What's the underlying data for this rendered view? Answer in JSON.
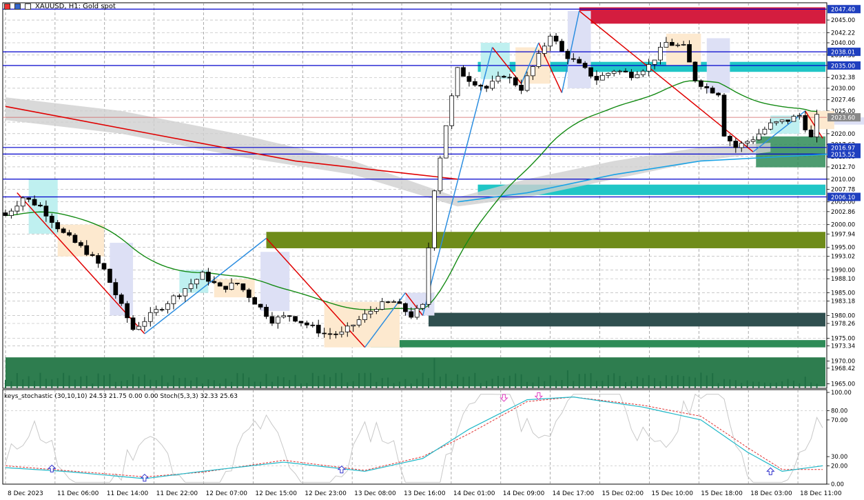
{
  "header": {
    "title": "XAUUSD, H1:  Gold spot"
  },
  "indicator": {
    "title": "keys_stochastic (30,10,10) 24.53 21.75 0.00 0.00 Stoch(5,3,3) 32.33 25.63"
  },
  "colors": {
    "bull": "#ffffff",
    "bear": "#000000",
    "ema_green": "#138a13",
    "ema_blue": "#1aa3e6",
    "line_red": "#e00000",
    "zigzag_blue": "#2b8de0",
    "hline": "#0000cc",
    "volume": "#2e8b57"
  },
  "chart_data": {
    "type": "candlestick",
    "symbol": "XAUUSD",
    "timeframe": "H1",
    "price_axis": {
      "ticks": [
        2045.0,
        2042.22,
        2040.0,
        2037.3,
        2035.0,
        2032.38,
        2030.0,
        2027.46,
        2025.0,
        2022.54,
        2020.0,
        2017.62,
        2015.0,
        2012.7,
        2010.0,
        2007.78,
        2005.0,
        2002.86,
        2000.0,
        1997.94,
        1995.0,
        1993.02,
        1990.0,
        1988.1,
        1985.0,
        1983.18,
        1980.0,
        1978.26,
        1975.0,
        1973.34,
        1970.0,
        1968.42,
        1965.0
      ],
      "range": [
        1964.0,
        2048.8
      ]
    },
    "price_labels": [
      {
        "value": 2047.4,
        "text": "2047.40",
        "color": "#1f3fbf"
      },
      {
        "value": 2038.01,
        "text": "2038.01",
        "color": "#1f3fbf"
      },
      {
        "value": 2035.0,
        "text": "2035.00",
        "color": "#1f3fbf"
      },
      {
        "value": 2023.6,
        "text": "2023.60",
        "color": "#888888"
      },
      {
        "value": 2016.97,
        "text": "2016.97",
        "color": "#1f3fbf"
      },
      {
        "value": 2015.52,
        "text": "2015.52",
        "color": "#1f3fbf"
      },
      {
        "value": 2006.1,
        "text": "2006.10",
        "color": "#1f3fbf"
      }
    ],
    "time_axis": [
      "8 Dec 2023",
      "11 Dec 06:00",
      "11 Dec 14:00",
      "11 Dec 22:00",
      "12 Dec 07:00",
      "12 Dec 15:00",
      "12 Dec 23:00",
      "13 Dec 08:00",
      "13 Dec 16:00",
      "14 Dec 01:00",
      "14 Dec 09:00",
      "14 Dec 17:00",
      "15 Dec 02:00",
      "15 Dec 10:00",
      "15 Dec 18:00",
      "18 Dec 03:00",
      "18 Dec 11:00"
    ],
    "horizontal_lines": [
      2047.4,
      2038.01,
      2035.0,
      2016.97,
      2015.52,
      2010.0,
      2006.1
    ],
    "current_price": 2023.6,
    "close_waypoints": [
      [
        0,
        2002
      ],
      [
        3,
        2006
      ],
      [
        6,
        2004
      ],
      [
        10,
        1998
      ],
      [
        14,
        1994
      ],
      [
        17,
        1990
      ],
      [
        20,
        1982
      ],
      [
        22,
        1977
      ],
      [
        24,
        1979
      ],
      [
        27,
        1982
      ],
      [
        30,
        1985
      ],
      [
        34,
        1989
      ],
      [
        37,
        1986
      ],
      [
        40,
        1987
      ],
      [
        43,
        1983
      ],
      [
        46,
        1979
      ],
      [
        49,
        1980
      ],
      [
        52,
        1978
      ],
      [
        55,
        1976
      ],
      [
        58,
        1976
      ],
      [
        61,
        1979
      ],
      [
        64,
        1982
      ],
      [
        67,
        1983
      ],
      [
        70,
        1980
      ],
      [
        72,
        1982
      ],
      [
        74,
        2008
      ],
      [
        76,
        2022
      ],
      [
        78,
        2034
      ],
      [
        80,
        2032
      ],
      [
        83,
        2030
      ],
      [
        86,
        2033
      ],
      [
        89,
        2030
      ],
      [
        92,
        2037
      ],
      [
        94,
        2042
      ],
      [
        96,
        2038
      ],
      [
        99,
        2035
      ],
      [
        102,
        2032
      ],
      [
        105,
        2034
      ],
      [
        108,
        2033
      ],
      [
        111,
        2035
      ],
      [
        114,
        2040
      ],
      [
        117,
        2039
      ],
      [
        119,
        2032
      ],
      [
        121,
        2030
      ],
      [
        123,
        2029
      ],
      [
        124,
        2020
      ],
      [
        126,
        2017
      ],
      [
        129,
        2019
      ],
      [
        132,
        2022
      ],
      [
        135,
        2023
      ],
      [
        137,
        2024
      ],
      [
        139,
        2019
      ],
      [
        140,
        2023.6
      ]
    ],
    "stochastic": {
      "levels": [
        100.0,
        80.0,
        70.0,
        30.0,
        20.0,
        0.0
      ],
      "k": 24.53,
      "d": 21.75,
      "stoch_k": 32.33,
      "stoch_d": 25.63
    }
  }
}
